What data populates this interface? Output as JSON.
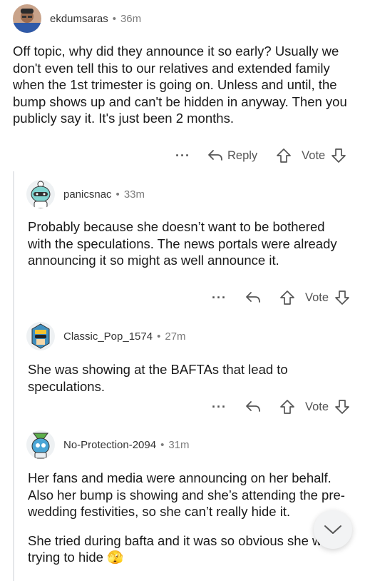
{
  "comments": [
    {
      "username": "ekdumsaras",
      "separator": "•",
      "time": "36m",
      "paragraphs": [
        "Off topic, why did they announce it so early? Usually we don't even tell this to our relatives and extended family when the 1st trimester is going on. Unless and until, the bump shows up and can't be hidden in anyway. Then you publicly say it. It's just been 2 months."
      ],
      "more": "···",
      "reply_label": "Reply",
      "vote_label": "Vote"
    },
    {
      "username": "panicsnac",
      "separator": "•",
      "time": "33m",
      "paragraphs": [
        "Probably because she doesn’t want to be bothered with the speculations. The news portals were already announcing it so might as well announce it."
      ],
      "more": "···",
      "vote_label": "Vote"
    },
    {
      "username": "Classic_Pop_1574",
      "separator": "•",
      "time": "27m",
      "paragraphs": [
        "She was showing at the BAFTAs that lead to speculations."
      ],
      "more": "···",
      "vote_label": "Vote"
    },
    {
      "username": "No-Protection-2094",
      "separator": "•",
      "time": "31m",
      "paragraphs": [
        "Her fans and media were announcing on her behalf. Also her bump is showing and she’s attending the pre-wedding festivities, so she can’t really hide it.",
        "She tried during bafta and it was so obvious she was trying to hide 🫣"
      ]
    }
  ],
  "icons": {
    "reply": "reply-arrow-icon",
    "upvote": "upvote-arrow-icon",
    "downvote": "downvote-arrow-icon",
    "scroll": "chevron-down-icon"
  },
  "colors": {
    "meta": "#7c7c7c",
    "text": "#1a1a1a",
    "thread": "#e5e7ea"
  }
}
